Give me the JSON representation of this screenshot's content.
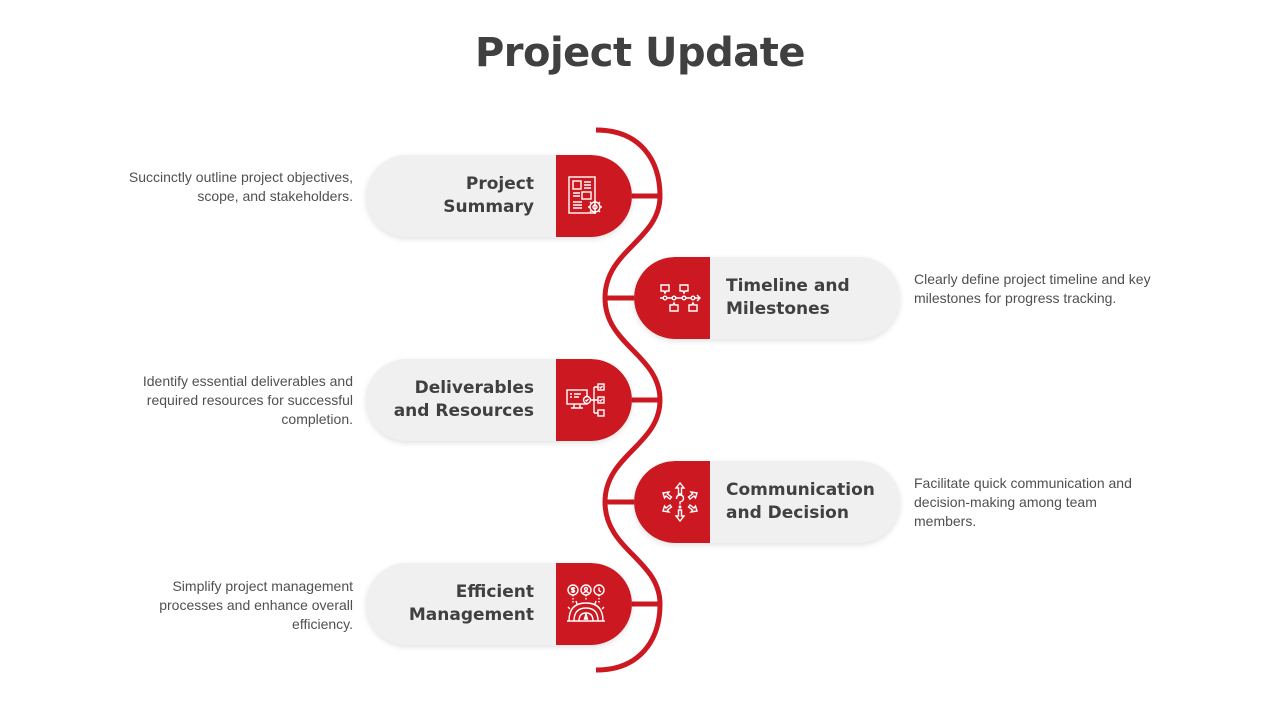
{
  "title": "Project Update",
  "colors": {
    "accent": "#cc1821",
    "pill_bg": "#f0f0f0",
    "text_dark": "#404040"
  },
  "steps": [
    {
      "label": "Project Summary",
      "description": "Succinctly outline project objectives, scope, and stakeholders.",
      "icon": "document-gear-icon",
      "side": "left"
    },
    {
      "label": "Timeline and Milestones",
      "description": "Clearly define project timeline and key milestones for progress tracking.",
      "icon": "timeline-icon",
      "side": "right"
    },
    {
      "label": "Deliverables and Resources",
      "description": "Identify essential deliverables and required resources for successful completion.",
      "icon": "monitor-checklist-icon",
      "side": "left"
    },
    {
      "label": "Communication and Decision",
      "description": "Facilitate quick communication and decision-making among team members.",
      "icon": "decision-arrows-icon",
      "side": "right"
    },
    {
      "label": "Efficient Management",
      "description": "Simplify project management processes and enhance overall efficiency.",
      "icon": "gauge-gear-icon",
      "side": "left"
    }
  ]
}
